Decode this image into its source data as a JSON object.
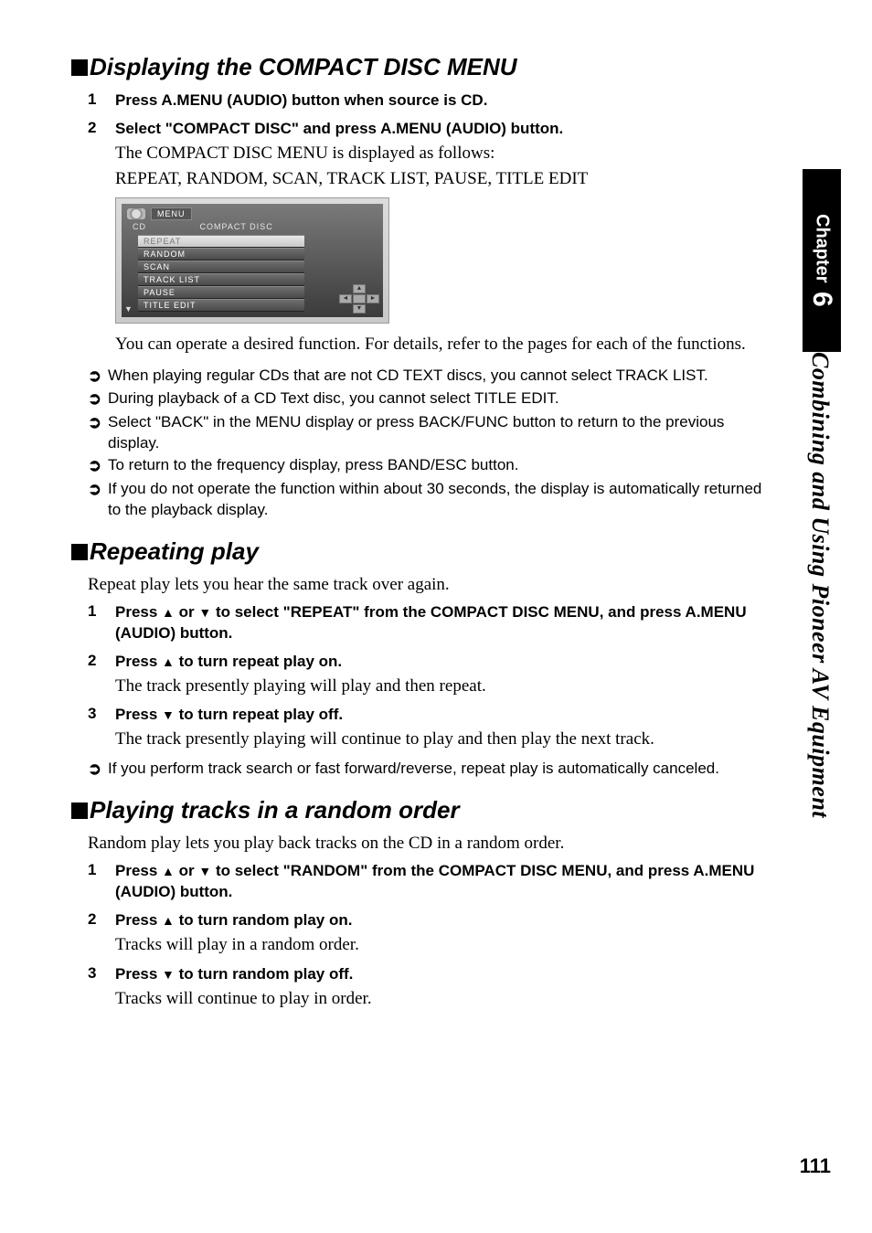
{
  "sidebar": {
    "chapter_label": "Chapter",
    "chapter_num": "6",
    "title": "Combining and Using Pioneer AV Equipment"
  },
  "page_number": "111",
  "section1": {
    "heading": "Displaying the COMPACT DISC MENU",
    "steps": [
      {
        "num": "1",
        "head": "Press A.MENU (AUDIO) button when source is CD."
      },
      {
        "num": "2",
        "head": "Select \"COMPACT DISC\" and press A.MENU (AUDIO) button.",
        "para1": "The COMPACT DISC MENU is displayed as follows:",
        "para2": "REPEAT, RANDOM, SCAN, TRACK LIST, PAUSE, TITLE EDIT"
      }
    ],
    "screenshot": {
      "menu_btn": "MENU",
      "crumb_left": "CD",
      "crumb_right": "COMPACT DISC",
      "items": [
        "REPEAT",
        "RANDOM",
        "SCAN",
        "TRACK LIST",
        "PAUSE",
        "TITLE EDIT"
      ]
    },
    "note": "You can operate a desired function. For details, refer to the pages for each of the functions.",
    "bullets": [
      "When playing regular CDs that are not CD TEXT discs, you cannot select TRACK LIST.",
      "During playback of a CD Text disc, you cannot select TITLE EDIT.",
      "Select \"BACK\" in the MENU display or press BACK/FUNC button to return to the previous display.",
      "To return to the frequency display, press BAND/ESC button.",
      "If you do not operate the function within about 30 seconds, the display is automatically returned to the playback display."
    ]
  },
  "section2": {
    "heading": "Repeating play",
    "intro": "Repeat play lets you hear the same track over again.",
    "steps": [
      {
        "num": "1",
        "head_pre": "Press ",
        "head_post": " to select \"REPEAT\" from the COMPACT DISC MENU, and press A.MENU (AUDIO) button."
      },
      {
        "num": "2",
        "head_pre": "Press ",
        "head_post": " to turn repeat play on.",
        "para": "The track presently playing will play and then repeat."
      },
      {
        "num": "3",
        "head_pre": "Press ",
        "head_post": " to turn repeat play off.",
        "para": "The track presently playing will continue to play and then play the next track."
      }
    ],
    "bullets": [
      "If you perform track search or fast forward/reverse, repeat play is automatically canceled."
    ]
  },
  "section3": {
    "heading": "Playing tracks in a random order",
    "intro": "Random play lets you play back tracks on the CD in a random order.",
    "steps": [
      {
        "num": "1",
        "head_pre": "Press ",
        "head_post": " to select \"RANDOM\" from the COMPACT DISC MENU, and press A.MENU (AUDIO) button."
      },
      {
        "num": "2",
        "head_pre": "Press ",
        "head_post": " to turn random play on.",
        "para": "Tracks will play in a random order."
      },
      {
        "num": "3",
        "head_pre": "Press ",
        "head_post": " to turn random play off.",
        "para": "Tracks will continue to play in order."
      }
    ]
  },
  "glyph": {
    "up": "▲",
    "down": "▼",
    "or": " or ",
    "arrow": "➲"
  }
}
